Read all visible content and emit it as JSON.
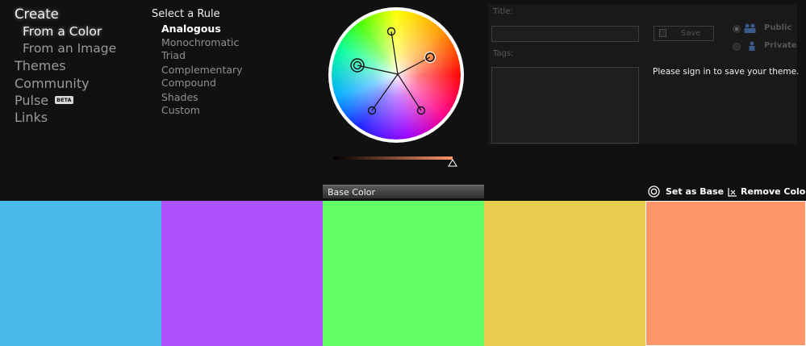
{
  "nav": {
    "create": "Create",
    "from_color": "From a Color",
    "from_image": "From an Image",
    "themes": "Themes",
    "community": "Community",
    "pulse": "Pulse",
    "beta": "BETA",
    "links": "Links"
  },
  "rules": {
    "title": "Select a Rule",
    "items": [
      "Analogous",
      "Monochromatic",
      "Triad",
      "Complementary",
      "Compound",
      "Shades",
      "Custom"
    ],
    "selected": "Analogous"
  },
  "form": {
    "title_label": "Title:",
    "title_value": "",
    "tags_label": "Tags:",
    "tags_value": "",
    "save_label": "Save",
    "public_label": "Public",
    "private_label": "Private",
    "visibility_selected": "Public",
    "signin_message": "Please sign in to save your theme."
  },
  "swatch_bar": {
    "base_label": "Base Color",
    "set_base_label": "Set as Base",
    "remove_label": "Remove Color"
  },
  "brightness_level": 1.0,
  "swatches": [
    {
      "color": "#4ab8e8"
    },
    {
      "color": "#ae51fe"
    },
    {
      "color": "#62fe65"
    },
    {
      "color": "#e8cd4e"
    },
    {
      "color": "#ff956a"
    }
  ],
  "selected_swatch": 4,
  "base_swatch": 2
}
